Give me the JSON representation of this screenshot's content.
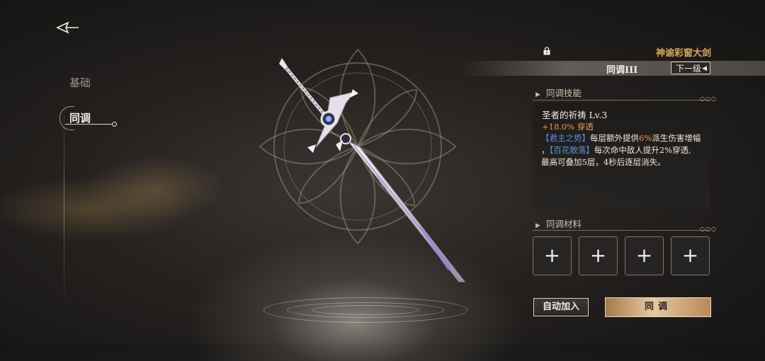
{
  "nav": {
    "items": [
      {
        "label": "基础",
        "active": false
      },
      {
        "label": "同调",
        "active": true
      }
    ]
  },
  "weapon": {
    "name": "神谕彩窗大剑",
    "sync_level": "同调III",
    "next_button": "下一级"
  },
  "skill_section": {
    "header": "同调技能",
    "skill_name": "圣者的祈祷 Lv.3",
    "stat": "+18.0% 穿透",
    "desc": {
      "kw1": "【君主之势】",
      "t1": "每层额外提供",
      "pct1": "6%",
      "t2": "派生伤害增幅",
      "comma": "，",
      "kw2": "【百花散落】",
      "t3": "每次命中敌人提升2%穿透,",
      "t4": "最高可叠加5层，4秒后逐层消失。"
    }
  },
  "material_section": {
    "header": "同调材料",
    "slots": [
      "+",
      "+",
      "+",
      "+"
    ]
  },
  "buttons": {
    "auto_add": "自动加入",
    "sync": "同调"
  },
  "colors": {
    "accent_gold": "#d8a95c",
    "keyword_blue": "#5b8fd6",
    "stat_orange": "#e59a5d"
  }
}
